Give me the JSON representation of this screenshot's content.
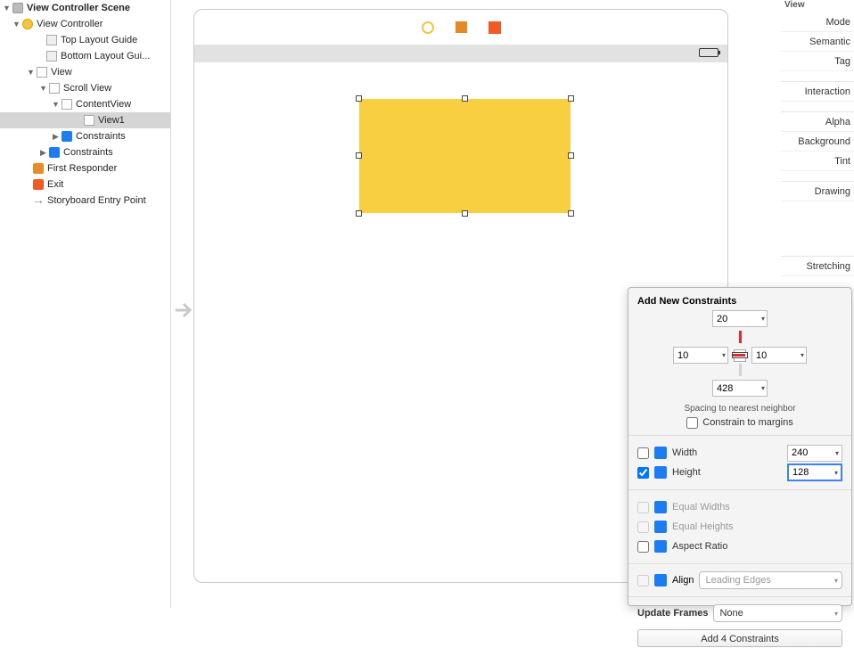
{
  "outline": {
    "scene": "View Controller Scene",
    "vc": "View Controller",
    "top_guide": "Top Layout Guide",
    "bot_guide": "Bottom Layout Gui...",
    "view": "View",
    "scroll": "Scroll View",
    "content": "ContentView",
    "view1": "View1",
    "constraints_inner": "Constraints",
    "constraints_outer": "Constraints",
    "first_responder": "First Responder",
    "exit": "Exit",
    "entry": "Storyboard Entry Point"
  },
  "inspector": {
    "section": "View",
    "mode": "Mode",
    "semantic": "Semantic",
    "tag": "Tag",
    "interaction": "Interaction",
    "alpha": "Alpha",
    "background": "Background",
    "tint": "Tint",
    "drawing": "Drawing",
    "stretching": "Stretching"
  },
  "pop": {
    "title": "Add New Constraints",
    "top": "20",
    "left": "10",
    "right": "10",
    "bottom": "428",
    "spacing": "Spacing to nearest neighbor",
    "margins": "Constrain to margins",
    "width_l": "Width",
    "width_v": "240",
    "height_l": "Height",
    "height_v": "128",
    "eq_w": "Equal Widths",
    "eq_h": "Equal Heights",
    "aspect": "Aspect Ratio",
    "align": "Align",
    "align_v": "Leading Edges",
    "upd": "Update Frames",
    "upd_v": "None",
    "add": "Add 4 Constraints"
  }
}
